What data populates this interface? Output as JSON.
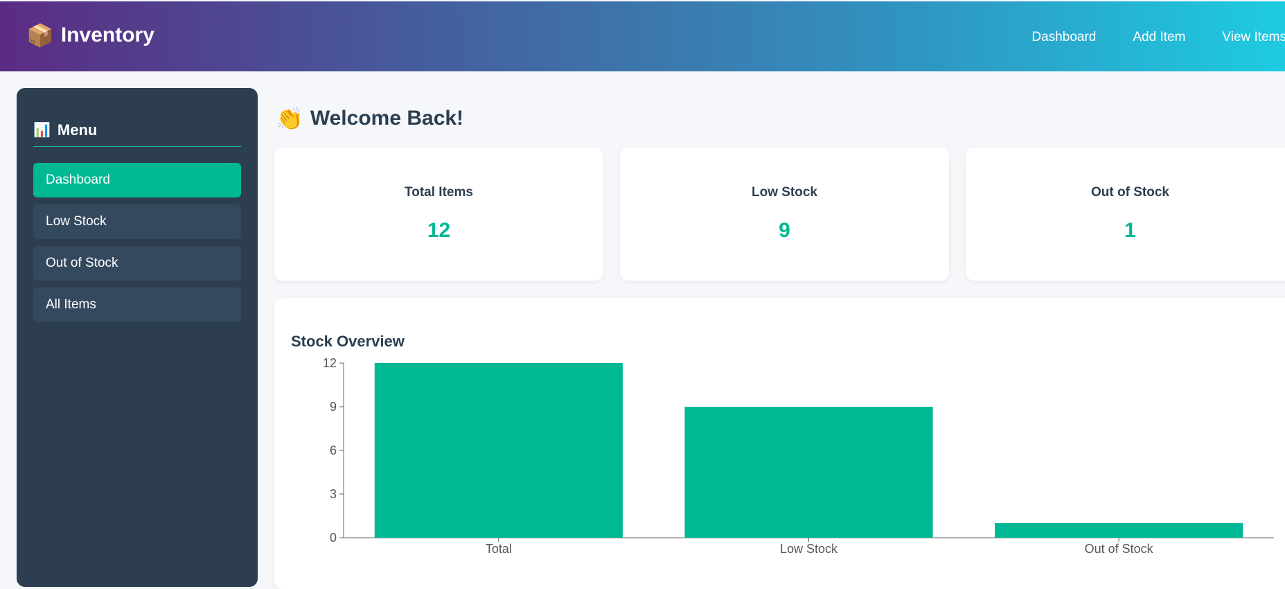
{
  "header": {
    "brand_icon": "📦",
    "brand": "Inventory",
    "nav": [
      "Dashboard",
      "Add Item",
      "View Items"
    ]
  },
  "sidebar": {
    "title_icon": "📊",
    "title": "Menu",
    "items": [
      {
        "label": "Dashboard",
        "active": true
      },
      {
        "label": "Low Stock",
        "active": false
      },
      {
        "label": "Out of Stock",
        "active": false
      },
      {
        "label": "All Items",
        "active": false
      }
    ]
  },
  "main": {
    "welcome_icon": "👏",
    "welcome": "Welcome Back!",
    "cards": [
      {
        "label": "Total Items",
        "value": "12"
      },
      {
        "label": "Low Stock",
        "value": "9"
      },
      {
        "label": "Out of Stock",
        "value": "1"
      }
    ]
  },
  "colors": {
    "accent": "#00b894",
    "sidebar_bg": "#2c3e50",
    "sidebar_item_bg": "#34495e"
  },
  "chart_data": {
    "type": "bar",
    "title": "Stock Overview",
    "categories": [
      "Total",
      "Low Stock",
      "Out of Stock"
    ],
    "values": [
      12,
      9,
      1
    ],
    "yticks": [
      0,
      3,
      6,
      9,
      12
    ],
    "ylim": [
      0,
      12
    ],
    "xlabel": "",
    "ylabel": "",
    "grid": false,
    "bar_color": "#00b894"
  }
}
